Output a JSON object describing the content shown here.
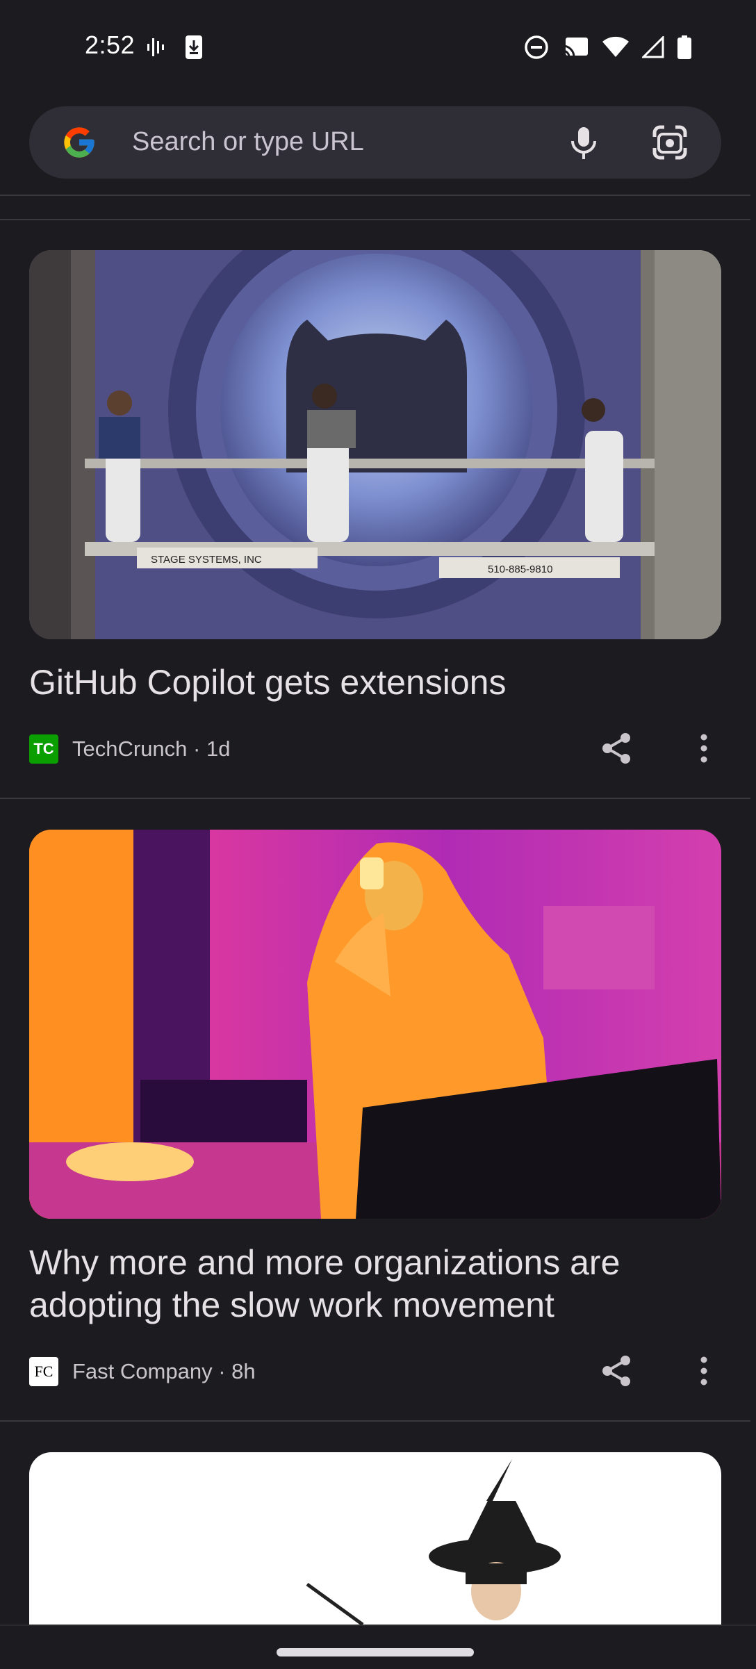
{
  "status_bar": {
    "time": "2:52"
  },
  "search": {
    "placeholder": "Search or type URL"
  },
  "articles": [
    {
      "title": "GitHub Copilot gets extensions",
      "publisher": "TechCrunch",
      "age": "1d",
      "meta": "TechCrunch · 1d",
      "logo_text": "TC",
      "logo_color": "#0a9e01"
    },
    {
      "title": "Why more and more organizations are adopting the slow work movement",
      "publisher": "Fast Company",
      "age": "8h",
      "meta": "Fast Company · 8h",
      "logo_text": "FC",
      "logo_color": "#ffffff"
    }
  ],
  "image_text": {
    "platform_label": "STAGE SYSTEMS, INC",
    "platform_phone": "510-885-9810"
  },
  "colors": {
    "background": "#1c1b1f",
    "search_bg": "#2f2d35",
    "accent_google_blue": "#4285f4"
  }
}
